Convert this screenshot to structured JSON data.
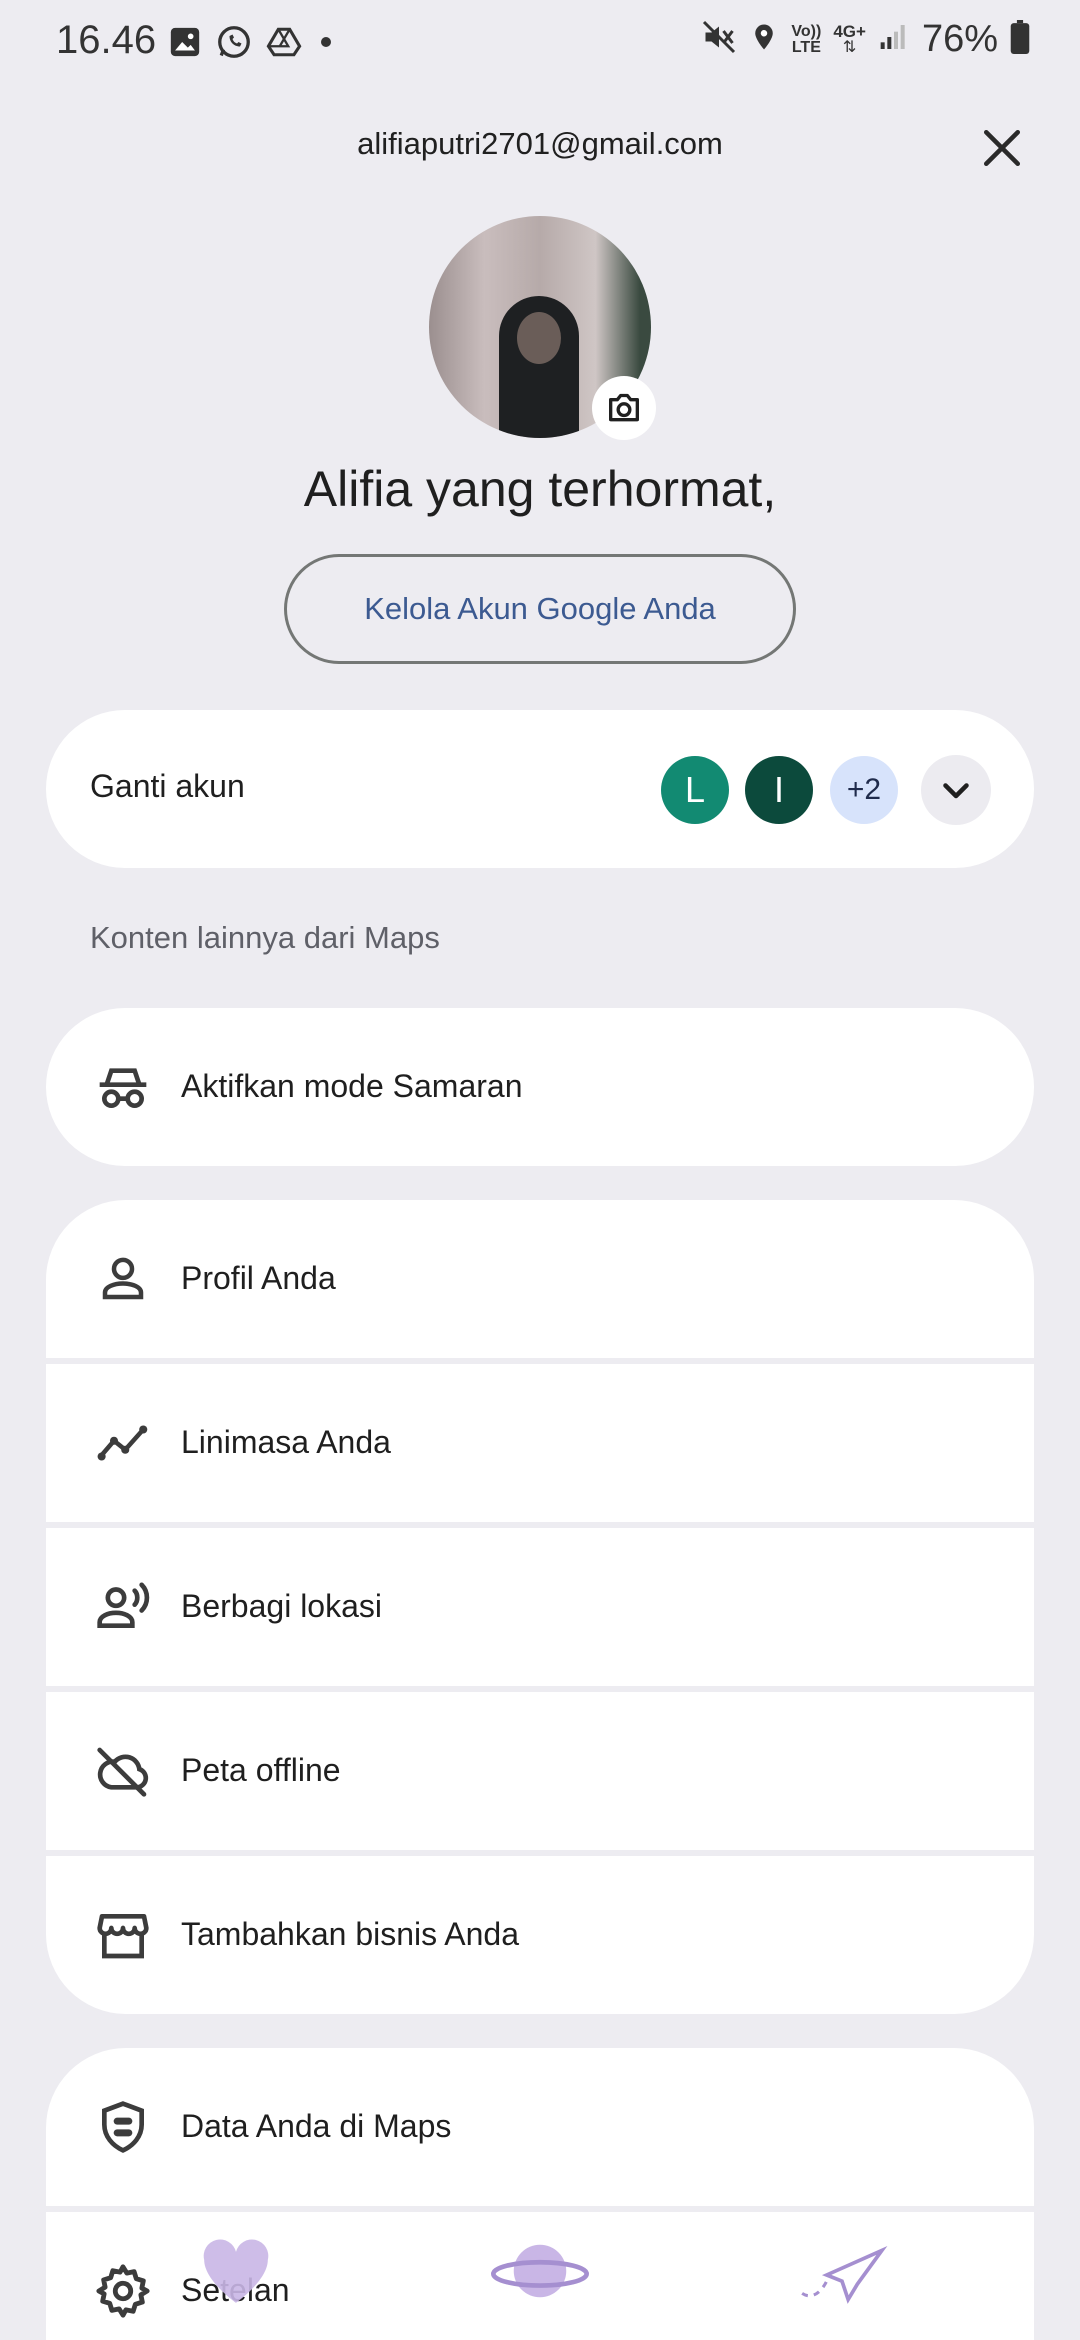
{
  "status_bar": {
    "time": "16.46",
    "battery": "76%",
    "left_icons": [
      "gallery-icon",
      "whatsapp-icon",
      "drive-icon",
      "dot-icon"
    ],
    "right_icons": [
      "mute-icon",
      "location-icon",
      "volte-icon",
      "4g-icon",
      "signal-icon",
      "battery-icon"
    ],
    "volte_text": "Vo))",
    "lte_text": "LTE",
    "net_text": "4G+"
  },
  "account": {
    "email": "alifiaputri2701@gmail.com",
    "greeting": "Alifia yang terhormat,",
    "manage_label": "Kelola Akun Google Anda"
  },
  "switch_account": {
    "label": "Ganti akun",
    "accounts": [
      {
        "initial": "L",
        "color": "#128a72"
      },
      {
        "initial": "I",
        "color": "#0c4a3c"
      }
    ],
    "more": "+2"
  },
  "section": {
    "label": "Konten lainnya dari Maps"
  },
  "incognito": {
    "label": "Aktifkan mode Samaran"
  },
  "menu": {
    "items": [
      {
        "label": "Profil Anda",
        "icon": "person-icon"
      },
      {
        "label": "Linimasa Anda",
        "icon": "timeline-icon"
      },
      {
        "label": "Berbagi lokasi",
        "icon": "location-sharing-icon"
      },
      {
        "label": "Peta offline",
        "icon": "cloud-off-icon"
      },
      {
        "label": "Tambahkan bisnis Anda",
        "icon": "storefront-icon"
      }
    ]
  },
  "menu2": {
    "items": [
      {
        "label": "Data Anda di Maps",
        "icon": "shield-data-icon"
      },
      {
        "label": "Setelan",
        "icon": "gear-icon"
      }
    ]
  },
  "colors": {
    "background": "#edecf1",
    "card": "#ffffff",
    "accent_text": "#3c5a91"
  }
}
